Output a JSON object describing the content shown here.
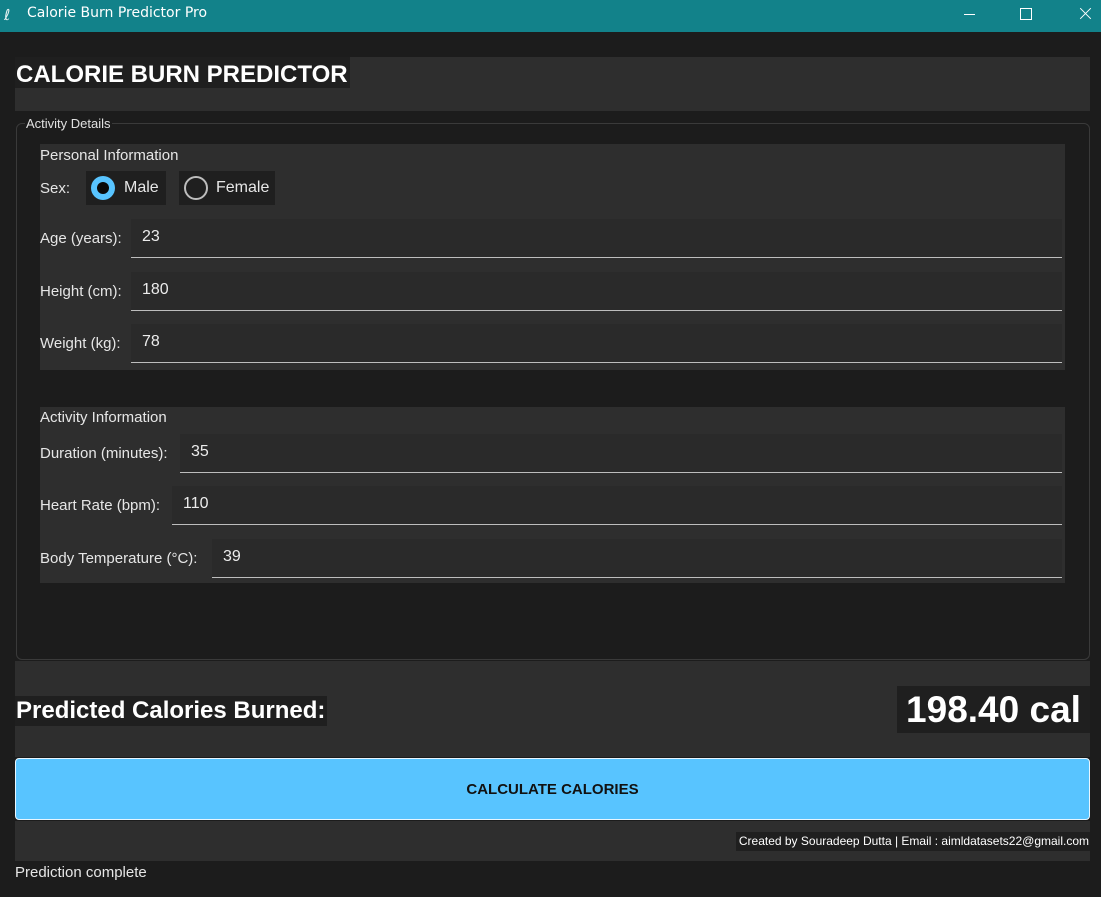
{
  "window": {
    "title": "Calorie Burn Predictor Pro"
  },
  "header": {
    "title": "CALORIE BURN PREDICTOR"
  },
  "activity_details": {
    "title": "Activity Details",
    "personal": {
      "title": "Personal Information",
      "sex": {
        "label": "Sex:",
        "options": [
          "Male",
          "Female"
        ],
        "selected": "Male"
      },
      "age": {
        "label": "Age (years):",
        "value": "23"
      },
      "height": {
        "label": "Height (cm):",
        "value": "180"
      },
      "weight": {
        "label": "Weight (kg):",
        "value": "78"
      }
    },
    "activity": {
      "title": "Activity Information",
      "duration": {
        "label": "Duration (minutes):",
        "value": "35"
      },
      "heart_rate": {
        "label": "Heart Rate (bpm):",
        "value": "110"
      },
      "body_temp": {
        "label": "Body Temperature (°C):",
        "value": "39"
      }
    }
  },
  "result": {
    "label": "Predicted Calories Burned:",
    "value": "198.40 cal"
  },
  "actions": {
    "calculate_label": "CALCULATE CALORIES"
  },
  "footer": {
    "credit": "Created by Souradeep Dutta | Email : aimldatasets22@gmail.com"
  },
  "status": {
    "text": "Prediction complete"
  },
  "colors": {
    "titlebar": "#12828a",
    "accent": "#58c4ff",
    "background": "#1c1c1c",
    "panel": "#2e2e2e"
  }
}
